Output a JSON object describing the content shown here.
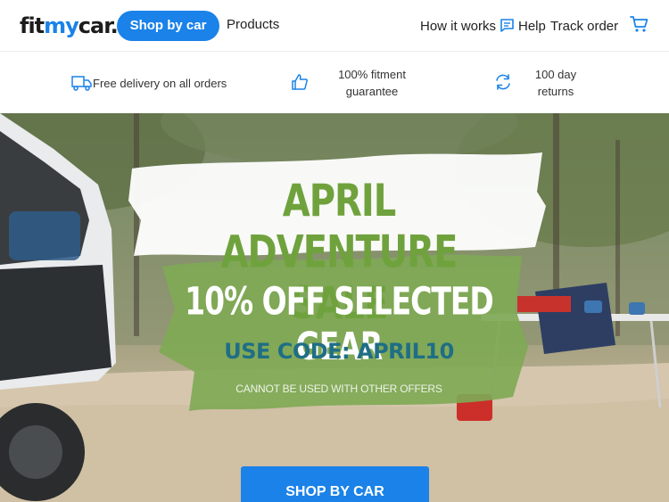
{
  "header": {
    "logo": {
      "part1": "fit",
      "part2": "my",
      "part3": "car."
    },
    "shop_by_car": "Shop by car",
    "products": "Products",
    "how_it_works": "How it works",
    "help": "Help",
    "track_order": "Track order",
    "icons": {
      "help": "chat-icon",
      "cart": "cart-icon"
    }
  },
  "benefits": [
    {
      "icon": "delivery-truck-icon",
      "lines": [
        "Free delivery on all orders"
      ]
    },
    {
      "icon": "thumbs-up-icon",
      "lines": [
        "100% fitment",
        "guarantee"
      ]
    },
    {
      "icon": "refresh-icon",
      "lines": [
        "100 day",
        "returns"
      ]
    }
  ],
  "hero": {
    "title": "APRIL ADVENTURE SALE",
    "subtitle": "10% OFF SELECTED GEAR",
    "code": "USE CODE: APRIL10",
    "note": "CANNOT BE USED WITH OTHER OFFERS",
    "cta": "SHOP BY CAR"
  },
  "colors": {
    "brand_blue": "#1a82e8",
    "sale_green": "#6fa23d",
    "code_teal": "#1f6e86"
  }
}
